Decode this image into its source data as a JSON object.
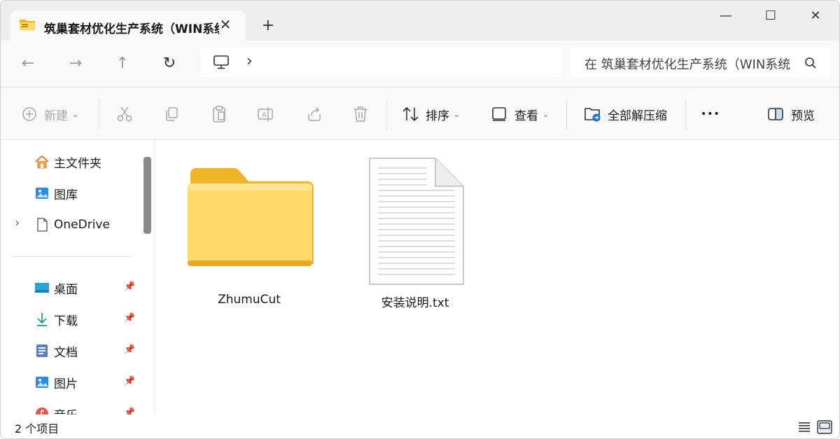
{
  "window": {
    "tab_title": "筑巢套材优化生产系统（WIN系统",
    "tab_close": "✕",
    "new_tab": "+",
    "minimize": "—",
    "maximize": "☐",
    "close": "✕"
  },
  "nav": {
    "back": "←",
    "forward": "→",
    "up": "↑",
    "refresh": "↻",
    "breadcrumb_chevron": "›",
    "search_text": "在 筑巢套材优化生产系统（WIN系统"
  },
  "commands": {
    "new_label": "新建",
    "sort_label": "排序",
    "view_label": "查看",
    "extract_all_label": "全部解压缩",
    "more_label": "•••",
    "preview_label": "预览"
  },
  "sidebar": {
    "items": [
      {
        "label": "主文件夹",
        "icon": "home-icon"
      },
      {
        "label": "图库",
        "icon": "gallery-icon"
      },
      {
        "label": "OneDrive",
        "icon": "file-icon"
      },
      {
        "label": "桌面",
        "icon": "desktop-icon"
      },
      {
        "label": "下载",
        "icon": "download-icon"
      },
      {
        "label": "文档",
        "icon": "document-icon"
      },
      {
        "label": "图片",
        "icon": "pictures-icon"
      },
      {
        "label": "音乐",
        "icon": "music-icon"
      }
    ],
    "expand_chevron": "›",
    "pin_glyph": "📌"
  },
  "files": [
    {
      "name": "ZhumuCut",
      "type": "folder"
    },
    {
      "name": "安装说明.txt",
      "type": "text-file"
    }
  ],
  "status": {
    "item_count": "2 个项目"
  },
  "colors": {
    "folder_dark": "#f0b429",
    "folder_light": "#ffd96a",
    "accent_blue": "#1f6fd1",
    "background": "#f9f9f9"
  }
}
